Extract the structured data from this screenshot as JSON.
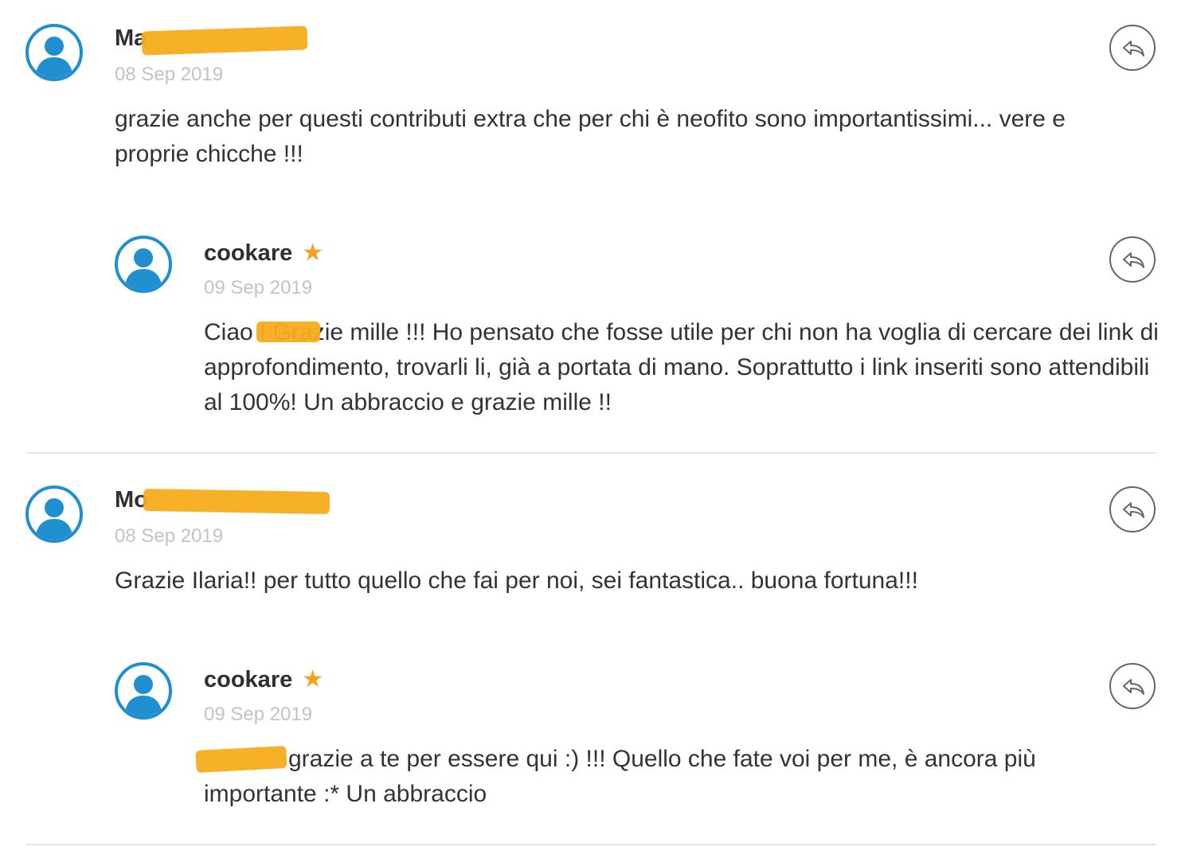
{
  "comments": [
    {
      "author": "Ma",
      "date": "08 Sep 2019",
      "text": "grazie anche per questi contributi extra che per chi è neofito sono importantissimi... vere e proprie chicche !!!"
    },
    {
      "author": "cookare",
      "date": "09 Sep 2019",
      "text": "Ciao ! Grazie mille !!! Ho pensato che fosse utile per chi non ha voglia di cercare dei link di approfondimento, trovarli li, già a portata di mano. Soprattutto i link inseriti sono attendibili al 100%! Un abbraccio e grazie mille !!"
    },
    {
      "author": "Mo",
      "date": "08 Sep 2019",
      "text": "Grazie Ilaria!! per tutto quello che fai per noi, sei fantastica.. buona fortuna!!!"
    },
    {
      "author": "cookare",
      "date": "09 Sep 2019",
      "text": " grazie a te per essere qui :) !!! Quello che fate voi per me, è ancora più importante :* Un abbraccio"
    }
  ],
  "icons": {
    "avatar": "user-avatar-icon",
    "reply": "reply-arrow-icon",
    "badge": "star-icon"
  },
  "colors": {
    "avatar_blue": "#1f8fcf",
    "star_orange": "#f5a023",
    "redaction_orange": "#f7ad1e",
    "date_gray": "#c3c3c3"
  }
}
